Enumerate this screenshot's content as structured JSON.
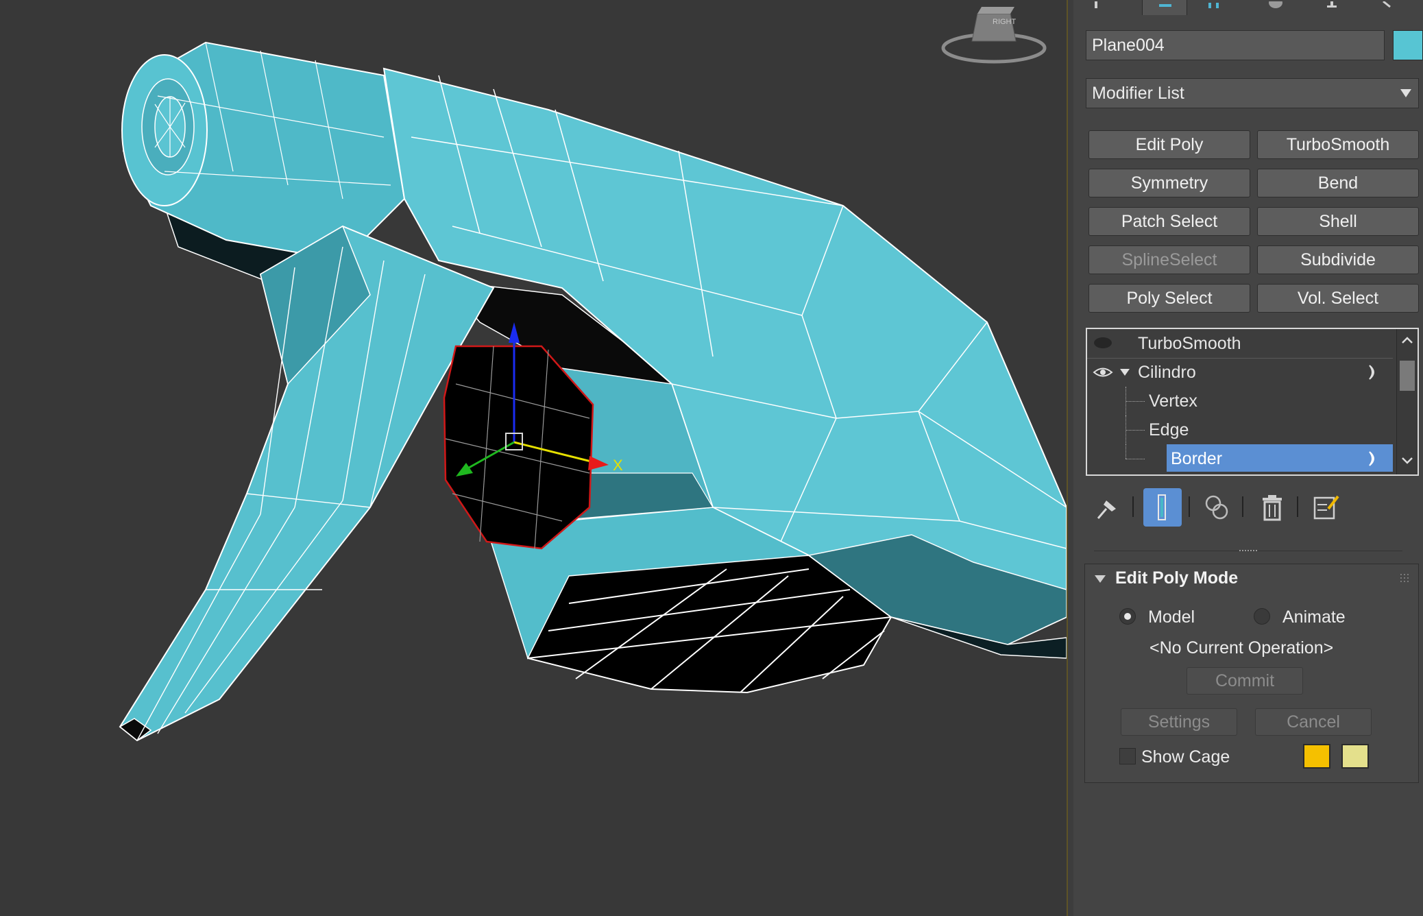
{
  "object": {
    "name": "Plane004",
    "color": "#57c5d3"
  },
  "modifier_list": {
    "label": "Modifier List"
  },
  "modifier_buttons": [
    {
      "label": "Edit Poly",
      "enabled": true
    },
    {
      "label": "TurboSmooth",
      "enabled": true
    },
    {
      "label": "Symmetry",
      "enabled": true
    },
    {
      "label": "Bend",
      "enabled": true
    },
    {
      "label": "Patch Select",
      "enabled": true
    },
    {
      "label": "Shell",
      "enabled": true
    },
    {
      "label": "SplineSelect",
      "enabled": false
    },
    {
      "label": "Subdivide",
      "enabled": true
    },
    {
      "label": "Poly Select",
      "enabled": true
    },
    {
      "label": "Vol. Select",
      "enabled": true
    }
  ],
  "stack": {
    "items": [
      {
        "label": "TurboSmooth",
        "type": "modifier",
        "visible": false
      },
      {
        "label": "Cilindro",
        "type": "object",
        "visible": true,
        "expanded": true
      },
      {
        "label": "Vertex",
        "type": "sub"
      },
      {
        "label": "Edge",
        "type": "sub"
      },
      {
        "label": "Border",
        "type": "sub",
        "selected": true
      }
    ]
  },
  "stack_toolbar": [
    "pin-stack-icon",
    "show-end-result-icon",
    "make-unique-icon",
    "remove-modifier-icon",
    "configure-modifier-sets-icon"
  ],
  "edit_poly_mode": {
    "title": "Edit Poly Mode",
    "mode_model": "Model",
    "mode_animate": "Animate",
    "selected_mode": "Model",
    "current_operation": "<No Current Operation>",
    "commit": "Commit",
    "settings": "Settings",
    "cancel": "Cancel",
    "show_cage": "Show Cage",
    "show_cage_checked": false,
    "cage_colors": [
      "#f5c000",
      "#e4e08c"
    ]
  },
  "viewcube": {
    "face_label": "RIGHT"
  },
  "gizmo": {
    "x_label": "X"
  }
}
